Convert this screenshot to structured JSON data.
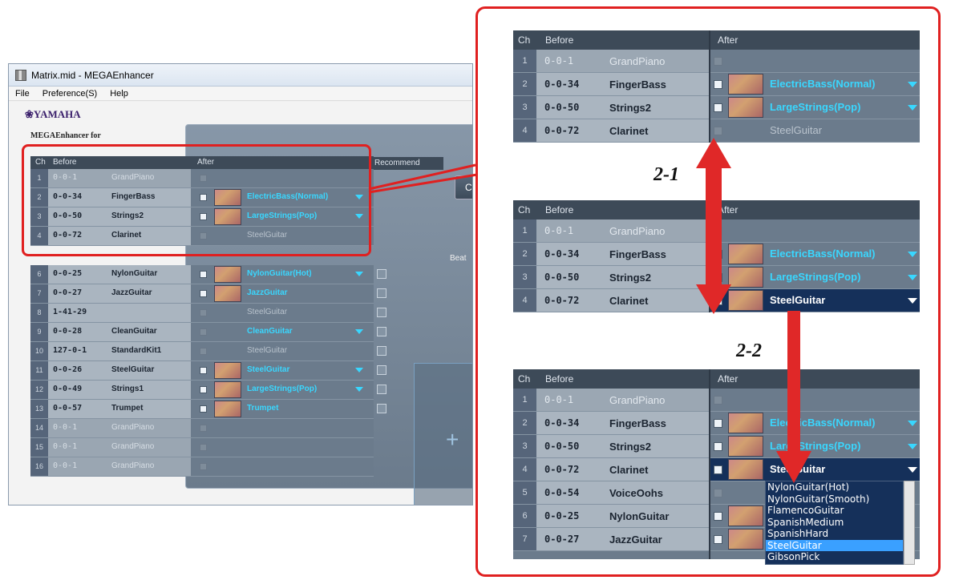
{
  "window": {
    "title": "Matrix.mid - MEGAEnhancer",
    "menu": [
      "File",
      "Preference(S)",
      "Help"
    ]
  },
  "brand": {
    "logo": "❀YAMAHA",
    "subtitle": "MEGAEnhancer for"
  },
  "headers": {
    "ch": "Ch",
    "before": "Before",
    "after": "After",
    "recommend": "Recommend"
  },
  "beat_label": "Beat",
  "c_button": "C",
  "rows": [
    {
      "ch": "1",
      "pc": "0-0-1",
      "voice": "GrandPiano",
      "after": "",
      "dim": true,
      "checked": false
    },
    {
      "ch": "2",
      "pc": "0-0-34",
      "voice": "FingerBass",
      "after": "ElectricBass(Normal)",
      "checked": true,
      "dropdown": true
    },
    {
      "ch": "3",
      "pc": "0-0-50",
      "voice": "Strings2",
      "after": "LargeStrings(Pop)",
      "checked": true,
      "dropdown": true
    },
    {
      "ch": "4",
      "pc": "0-0-72",
      "voice": "Clarinet",
      "after": "SteelGuitar",
      "checked": false,
      "gray": true
    },
    {
      "ch": "6",
      "pc": "0-0-25",
      "voice": "NylonGuitar",
      "after": "NylonGuitar(Hot)",
      "checked": true,
      "dropdown": true
    },
    {
      "ch": "7",
      "pc": "0-0-27",
      "voice": "JazzGuitar",
      "after": "JazzGuitar",
      "checked": true
    },
    {
      "ch": "8",
      "pc": "1-41-29",
      "voice": "",
      "after": "SteelGuitar",
      "checked": false,
      "gray": true
    },
    {
      "ch": "9",
      "pc": "0-0-28",
      "voice": "CleanGuitar",
      "after": "CleanGuitar",
      "checked": false,
      "dropdown": true
    },
    {
      "ch": "10",
      "pc": "127-0-1",
      "voice": "StandardKit1",
      "after": "SteelGuitar",
      "checked": false,
      "gray": true
    },
    {
      "ch": "11",
      "pc": "0-0-26",
      "voice": "SteelGuitar",
      "after": "SteelGuitar",
      "checked": true,
      "dropdown": true
    },
    {
      "ch": "12",
      "pc": "0-0-49",
      "voice": "Strings1",
      "after": "LargeStrings(Pop)",
      "checked": true,
      "dropdown": true
    },
    {
      "ch": "13",
      "pc": "0-0-57",
      "voice": "Trumpet",
      "after": "Trumpet",
      "checked": true
    },
    {
      "ch": "14",
      "pc": "0-0-1",
      "voice": "GrandPiano",
      "after": "",
      "dim": true
    },
    {
      "ch": "15",
      "pc": "0-0-1",
      "voice": "GrandPiano",
      "after": "",
      "dim": true
    },
    {
      "ch": "16",
      "pc": "0-0-1",
      "voice": "GrandPiano",
      "after": "",
      "dim": true
    }
  ],
  "zoom1": [
    {
      "ch": "1",
      "pc": "0-0-1",
      "voice": "GrandPiano",
      "after": ""
    },
    {
      "ch": "2",
      "pc": "0-0-34",
      "voice": "FingerBass",
      "after": "ElectricBass(Normal)"
    },
    {
      "ch": "3",
      "pc": "0-0-50",
      "voice": "Strings2",
      "after": "LargeStrings(Pop)"
    },
    {
      "ch": "4",
      "pc": "0-0-72",
      "voice": "Clarinet",
      "after": "SteelGuitar"
    }
  ],
  "zoom2": [
    {
      "ch": "1",
      "pc": "0-0-1",
      "voice": "GrandPiano",
      "after": ""
    },
    {
      "ch": "2",
      "pc": "0-0-34",
      "voice": "FingerBass",
      "after": "ElectricBass(Normal)"
    },
    {
      "ch": "3",
      "pc": "0-0-50",
      "voice": "Strings2",
      "after": "LargeStrings(Pop)"
    },
    {
      "ch": "4",
      "pc": "0-0-72",
      "voice": "Clarinet",
      "after": "SteelGuitar"
    }
  ],
  "zoom3": [
    {
      "ch": "1",
      "pc": "0-0-1",
      "voice": "GrandPiano",
      "after": ""
    },
    {
      "ch": "2",
      "pc": "0-0-34",
      "voice": "FingerBass",
      "after": "ElectricBass(Normal)"
    },
    {
      "ch": "3",
      "pc": "0-0-50",
      "voice": "Strings2",
      "after": "LargeStrings(Pop)"
    },
    {
      "ch": "4",
      "pc": "0-0-72",
      "voice": "Clarinet",
      "after": "SteelGuitar"
    },
    {
      "ch": "5",
      "pc": "0-0-54",
      "voice": "VoiceOohs",
      "after": ""
    },
    {
      "ch": "6",
      "pc": "0-0-25",
      "voice": "NylonGuitar",
      "after": ""
    },
    {
      "ch": "7",
      "pc": "0-0-27",
      "voice": "JazzGuitar",
      "after": ""
    }
  ],
  "dropdown_options": [
    "NylonGuitar(Hot)",
    "NylonGuitar(Smooth)",
    "FlamencoGuitar",
    "SpanishMedium",
    "SpanishHard",
    "SteelGuitar",
    "GibsonPick"
  ],
  "step_labels": {
    "s1": "2-1",
    "s2": "2-2"
  },
  "colors": {
    "accent": "#39d7ff",
    "highlight": "#e02020",
    "selected_row": "#15305a"
  }
}
